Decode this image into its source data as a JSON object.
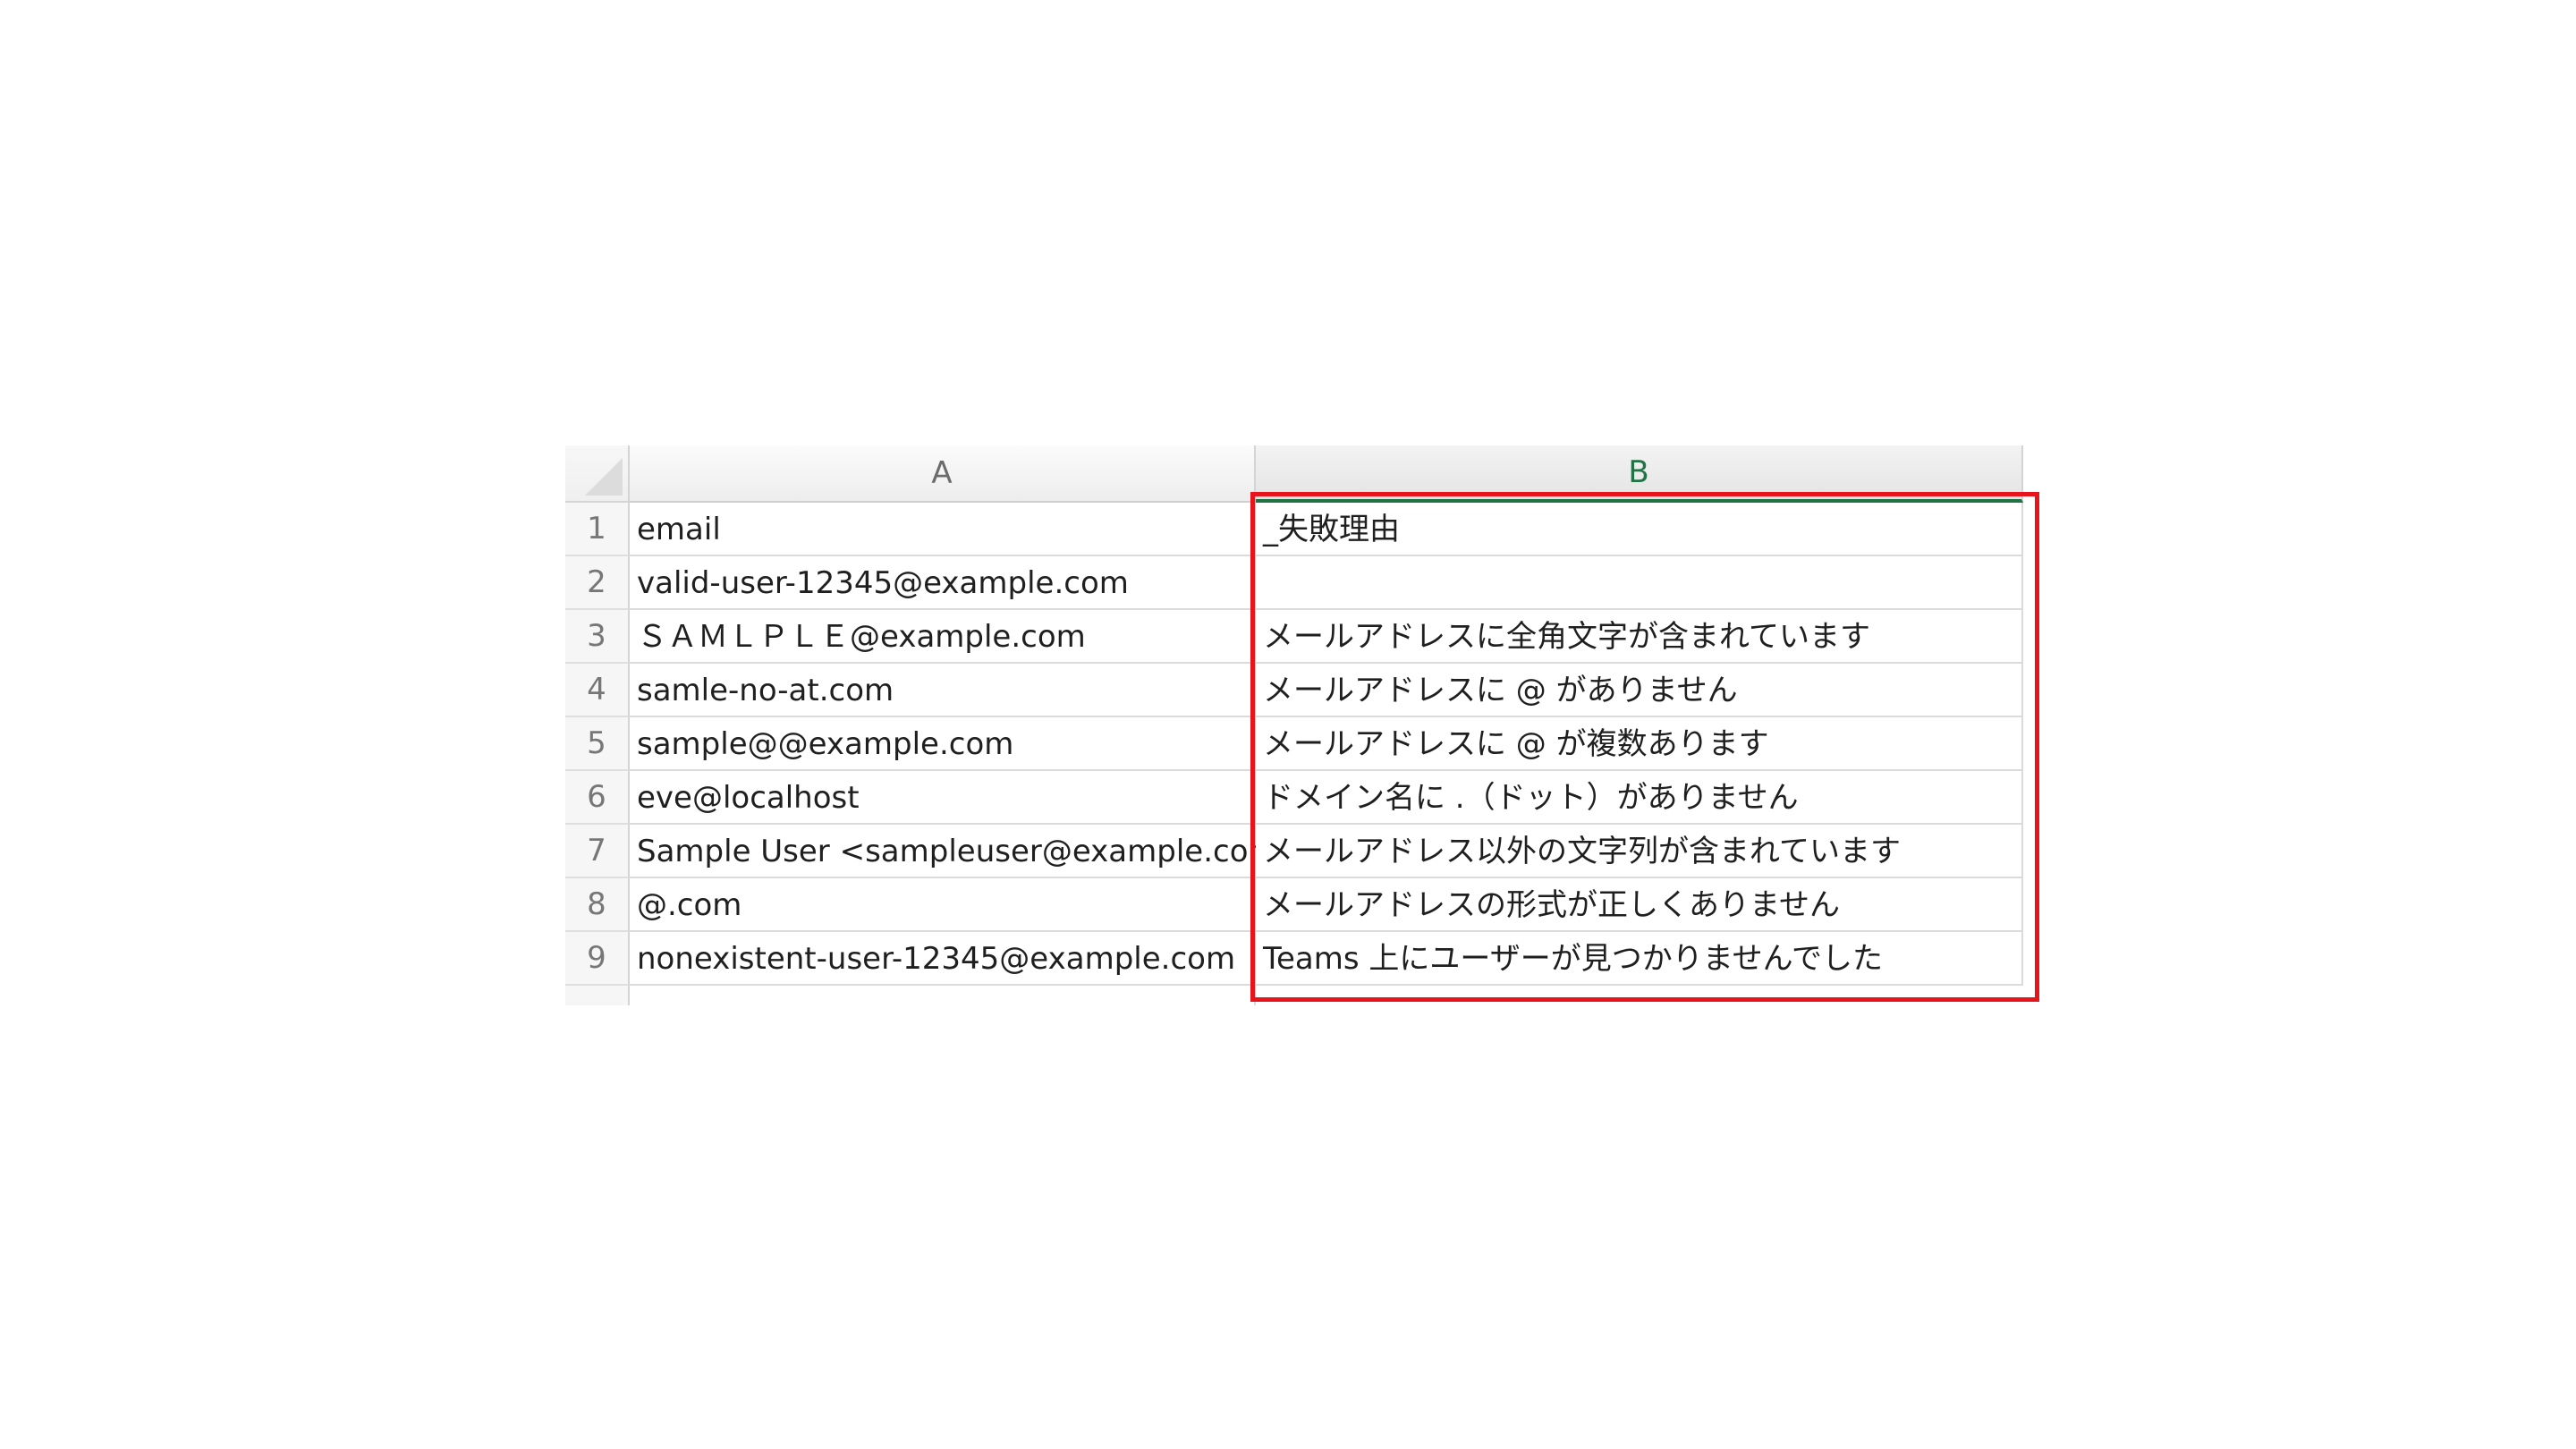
{
  "columns": {
    "a": "A",
    "b": "B"
  },
  "rows": [
    {
      "num": "1",
      "a": "email",
      "b": "_失敗理由"
    },
    {
      "num": "2",
      "a": "valid-user-12345@example.com",
      "b": ""
    },
    {
      "num": "3",
      "a": "ＳＡＭＬＰＬＥ@example.com",
      "b": "メールアドレスに全角文字が含まれています"
    },
    {
      "num": "4",
      "a": "samle-no-at.com",
      "b": "メールアドレスに @ がありません"
    },
    {
      "num": "5",
      "a": "sample@@example.com",
      "b": "メールアドレスに @ が複数あります"
    },
    {
      "num": "6",
      "a": "eve@localhost",
      "b": "ドメイン名に .（ドット）がありません"
    },
    {
      "num": "7",
      "a": "Sample User <sampleuser@example.com>",
      "b": "メールアドレス以外の文字列が含まれています"
    },
    {
      "num": "8",
      "a": "@.com",
      "b": "メールアドレスの形式が正しくありません"
    },
    {
      "num": "9",
      "a": "nonexistent-user-12345@example.com",
      "b": "Teams 上にユーザーが見つかりませんでした"
    }
  ],
  "colors": {
    "selected_header": "#217346",
    "highlight_box": "#e8141c"
  }
}
